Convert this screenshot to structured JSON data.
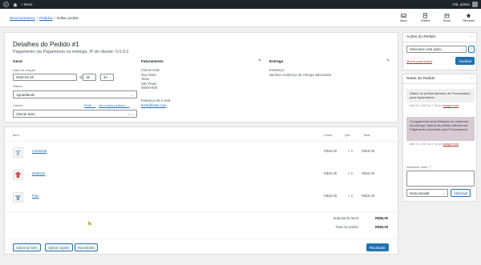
{
  "adminbar": {
    "new_label": "+ Novo",
    "user_label": "Olá, admin"
  },
  "breadcrumb": {
    "item1": "WooCommerce",
    "item2": "Pedidos",
    "current": "Editar pedido",
    "sep": "/"
  },
  "wcnav": [
    {
      "label": "Inbox",
      "icon": "inbox-icon"
    },
    {
      "label": "Orders",
      "icon": "orders-icon"
    },
    {
      "label": "Stock",
      "icon": "stock-icon"
    },
    {
      "label": "Reviews",
      "icon": "star-icon"
    }
  ],
  "order": {
    "title": "Detalhes do Pedido #1",
    "subtitle": "Pagamento via Pagamento na entrega. IP do cliente: 0.0.0.0",
    "general": {
      "heading": "Geral",
      "date_label": "Data de criação:",
      "date": "2020-04-10",
      "at": "@",
      "hour": "19",
      "minute": "34",
      "status_label": "Status:",
      "status": "Aguardando",
      "customer_label": "Cliente:",
      "profile_link": "Perfil →",
      "other_orders_link": "Ver outros pedidos →",
      "customer": "Cliente teste"
    },
    "billing": {
      "heading": "Faturamento",
      "lines": [
        "Cliente teste",
        "Rua Teste",
        "Teste",
        "São Paulo",
        "00000-000"
      ],
      "email_label": "Endereço de e-mail:",
      "email": "teste@teste.com"
    },
    "shipping": {
      "heading": "Entrega",
      "address_label": "Endereço:",
      "address": "Nenhum endereço de entrega adicionado."
    }
  },
  "items": {
    "headers": {
      "item": "Item",
      "cost": "Custo",
      "qty": "Qtd.",
      "total": "Total"
    },
    "rows": [
      {
        "name": "Camiseta",
        "cost": "R$18,00",
        "qty": "× 1",
        "total": "R$18,00",
        "icon": "tshirt-icon"
      },
      {
        "name": "Moletom",
        "cost": "R$42,00",
        "qty": "× 1",
        "total": "R$42,00",
        "icon": "hoodie-icon"
      },
      {
        "name": "Polo",
        "cost": "R$20,00",
        "qty": "× 1",
        "total": "R$20,00",
        "icon": "polo-icon"
      }
    ],
    "subtotal_label": "Subtotal de itens:",
    "subtotal": "R$80,00",
    "total_label": "Total do pedido:",
    "total": "R$80,00",
    "buttons": {
      "add": "Adicionar item",
      "coupon": "Aplicar cupom",
      "refund": "Reembolso",
      "recalc": "Recalcular"
    }
  },
  "actions": {
    "heading": "Ações do Pedido",
    "select_placeholder": "Selecione uma ação...",
    "go": "›",
    "trash": "Mover para lixeira",
    "update": "Atualizar"
  },
  "notes": {
    "heading": "Notas do Pedido",
    "list": [
      {
        "text": "Status do pedido alterado de Processando para Aguardando.",
        "meta": "abril 10, 2020 às 7:35 pm",
        "delete": "Apagar nota"
      },
      {
        "text": "O pagamento será efetuado no momento da entrega. Status do pedido alterado de Pagamento pendente para Processando.",
        "meta": "abril 10, 2020 às 7:34 pm",
        "delete": "Apagar nota"
      }
    ],
    "add_label": "Adicionar nota",
    "note_type": "Nota privada",
    "add_button": "Adicionar"
  },
  "colors": {
    "accent": "#2271b1",
    "adminbar": "#1d2327",
    "note_system": "#efefef",
    "note_customer": "#d7cad2"
  }
}
